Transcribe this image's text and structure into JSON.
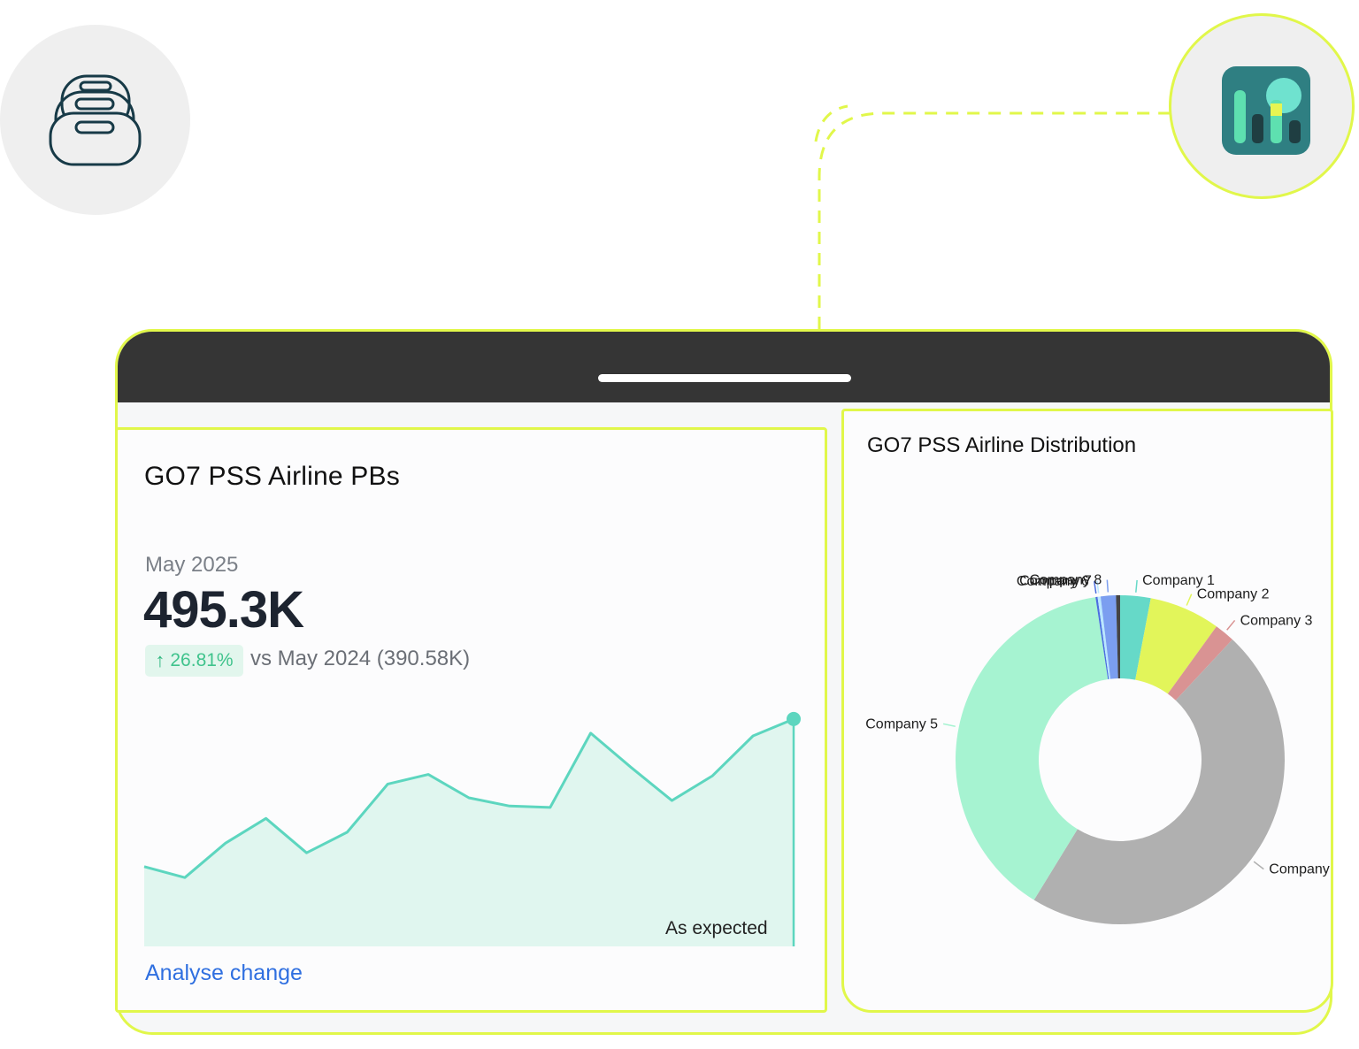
{
  "left_card": {
    "title": "GO7 PSS Airline PBs",
    "period": "May 2025",
    "metric_value": "495.3K",
    "delta_value": "26.81%",
    "delta_direction": "up",
    "comparison": "vs May 2024 (390.58K)",
    "status": "As expected",
    "action_label": "Analyse change"
  },
  "right_card": {
    "title": "GO7 PSS Airline Distribution"
  },
  "icons": {
    "top_left": "database-icon",
    "top_right": "analytics-chart-icon"
  },
  "colors": {
    "accent_border": "#e1f74a",
    "trend_line": "#5dd6bf",
    "trend_fill": "#e0f6ef",
    "link": "#2f6fe0",
    "positive": "#3fc38c"
  },
  "chart_data": [
    {
      "type": "area",
      "title": "GO7 PSS Airline PBs",
      "x": [
        1,
        2,
        3,
        4,
        5,
        6,
        7,
        8,
        9,
        10,
        11,
        12,
        13,
        14,
        15,
        16,
        17
      ],
      "values": [
        388,
        380,
        405,
        423,
        398,
        413,
        448,
        455,
        438,
        432,
        431,
        485,
        460,
        436,
        454,
        483,
        495.3
      ],
      "ylim": [
        330,
        510
      ],
      "grid": false
    },
    {
      "type": "pie",
      "title": "GO7 PSS Airline Distribution",
      "slices": [
        {
          "label": "Company 1",
          "value": 3.0,
          "color": "#66d9c8"
        },
        {
          "label": "Company 2",
          "value": 7.0,
          "color": "#e2f55a"
        },
        {
          "label": "Company 3",
          "value": 2.0,
          "color": "#d99393"
        },
        {
          "label": "Company",
          "value": 47.0,
          "color": "#b0b0b0"
        },
        {
          "label": "Company 5",
          "value": 39.0,
          "color": "#a6f3d1"
        },
        {
          "label": "Company 6",
          "value": 0.2,
          "color": "#4b6ee0"
        },
        {
          "label": "Company 7",
          "value": 0.3,
          "color": "#b9e7ff"
        },
        {
          "label": "Company 8",
          "value": 1.5,
          "color": "#7b9ef0"
        },
        {
          "label": "",
          "value": 0.4,
          "color": "#444444"
        }
      ]
    }
  ]
}
